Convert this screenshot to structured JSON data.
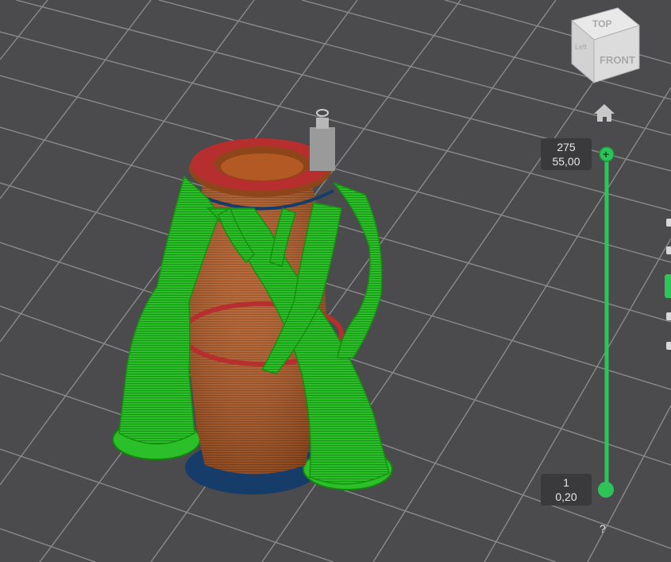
{
  "view_cube": {
    "top_label": "TOP",
    "front_label": "FRONT",
    "left_label": "Left"
  },
  "home_icon": "home-icon",
  "layer_slider": {
    "top_layer": "275",
    "top_height": "55,00",
    "bottom_layer": "1",
    "bottom_height": "0,20",
    "accent_color": "#2fc45a"
  },
  "help_label": "?",
  "colors": {
    "background": "#4b4b4d",
    "grid": "#8a8a8c",
    "model": "#b35a24",
    "support": "#27b624",
    "brim": "#163d69",
    "top_surface": "#b62e2e"
  }
}
